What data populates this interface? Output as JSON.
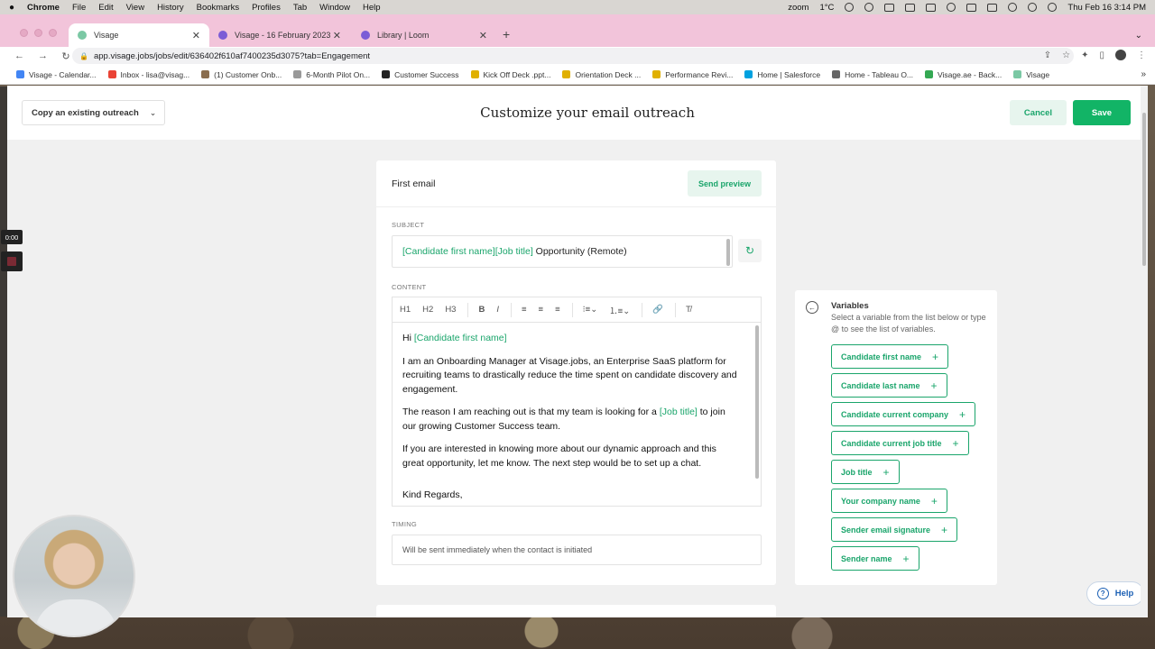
{
  "menubar": {
    "app": "Chrome",
    "items": [
      "File",
      "Edit",
      "View",
      "History",
      "Bookmarks",
      "Profiles",
      "Tab",
      "Window",
      "Help"
    ],
    "zoom": "zoom",
    "weather": "1°C",
    "datetime": "Thu Feb 16  3:14 PM"
  },
  "tabs": [
    {
      "label": "Visage",
      "active": true
    },
    {
      "label": "Visage - 16 February 2023",
      "active": false
    },
    {
      "label": "Library | Loom",
      "active": false
    }
  ],
  "address": {
    "url": "app.visage.jobs/jobs/edit/636402f610af7400235d3075?tab=Engagement"
  },
  "bookmarks": [
    "Visage - Calendar...",
    "Inbox - lisa@visag...",
    "(1) Customer Onb...",
    "6-Month Pilot On...",
    "Customer Success",
    "Kick Off Deck .ppt...",
    "Orientation Deck ...",
    "Performance Revi...",
    "Home | Salesforce",
    "Home - Tableau O...",
    "Visage.ae - Back...",
    "Visage"
  ],
  "header": {
    "copy_label": "Copy an existing outreach",
    "title": "Customize your email outreach",
    "cancel": "Cancel",
    "save": "Save"
  },
  "email": {
    "title": "First email",
    "send_preview": "Send preview",
    "subject_label": "SUBJECT",
    "subject_var1": "[Candidate first name]",
    "subject_var2": "[Job title]",
    "subject_text": " Opportunity (Remote)",
    "content_label": "CONTENT",
    "toolbar": [
      "H1",
      "H2",
      "H3",
      "B",
      "I"
    ],
    "greeting": "Hi ",
    "greeting_var": "[Candidate first name]",
    "p1": "I am an Onboarding Manager at Visage.jobs, an Enterprise SaaS platform for recruiting teams to drastically reduce the time spent on candidate discovery and engagement.",
    "p2_a": "The reason I am reaching out is that my team is looking for a ",
    "p2_var": "[Job title]",
    "p2_b": " to join our growing Customer Success team.",
    "p3": "If you are interested in knowing more about our dynamic approach and this great opportunity, let me know. The next step would be to set up a chat.",
    "signoff": "Kind Regards,",
    "timing_label": "TIMING",
    "timing_value": "Will be sent immediately when the contact is initiated"
  },
  "variables": {
    "title": "Variables",
    "description": "Select a variable from the list below or type @ to see the list of variables.",
    "items": [
      "Candidate first name",
      "Candidate last name",
      "Candidate current company",
      "Candidate current job title",
      "Job title",
      "Your company name",
      "Sender email signature",
      "Sender name"
    ]
  },
  "help": "Help",
  "recording": {
    "timer": "0:00"
  },
  "colors": {
    "accent": "#12b466",
    "tabstrip": "#f2c4da"
  }
}
